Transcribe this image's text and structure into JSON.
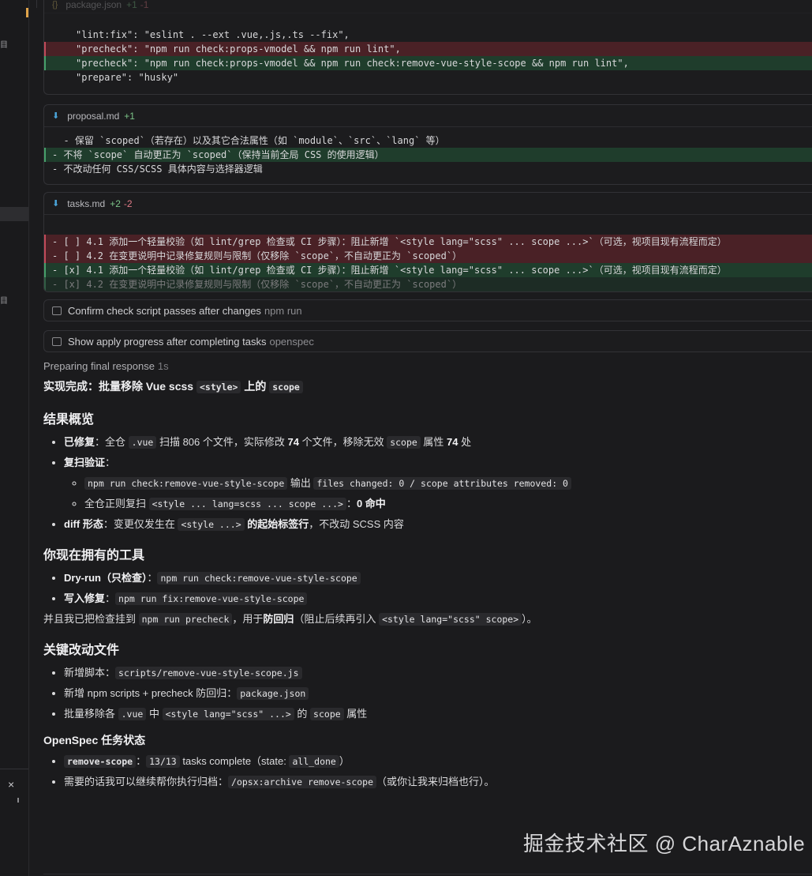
{
  "file1": {
    "name": "package.json",
    "added": "+1",
    "removed": "-1",
    "lines": [
      {
        "type": "ctx",
        "text": "\"lint:fix\": \"eslint . --ext .vue,.js,.ts --fix\","
      },
      {
        "type": "minus",
        "text": "\"precheck\": \"npm run check:props-vmodel && npm run lint\","
      },
      {
        "type": "plus",
        "text": "\"precheck\": \"npm run check:props-vmodel && npm run check:remove-vue-style-scope && npm run lint\","
      },
      {
        "type": "ctx",
        "text": "\"prepare\": \"husky\""
      }
    ]
  },
  "file2": {
    "name": "proposal.md",
    "added": "+1",
    "lines": [
      {
        "type": "ctx",
        "text": "  - 保留 `scoped`（若存在）以及其它合法属性（如 `module`、`src`、`lang` 等）"
      },
      {
        "type": "plus",
        "text": "- 不将 `scope` 自动更正为 `scoped`（保持当前全局 CSS 的使用逻辑）"
      },
      {
        "type": "ctx",
        "text": "- 不改动任何 CSS/SCSS 具体内容与选择器逻辑"
      }
    ]
  },
  "file3": {
    "name": "tasks.md",
    "added": "+2",
    "removed": "-2",
    "lines": [
      {
        "type": "minus",
        "text": "- [ ] 4.1 添加一个轻量校验（如 lint/grep 检查或 CI 步骤）：阻止新增 `<style lang=\"scss\" ... scope ...>`（可选，视项目现有流程而定）"
      },
      {
        "type": "minus",
        "text": "- [ ] 4.2 在变更说明中记录修复规则与限制（仅移除 `scope`，不自动更正为 `scoped`）"
      },
      {
        "type": "plus",
        "text": "- [x] 4.1 添加一个轻量校验（如 lint/grep 检查或 CI 步骤）：阻止新增 `<style lang=\"scss\" ... scope ...>`（可选，视项目现有流程而定）"
      },
      {
        "type": "plus",
        "text": "- [x] 4.2 在变更说明中记录修复规则与限制（仅移除 `scope`，不自动更正为 `scoped`）"
      }
    ]
  },
  "tasks": {
    "t1_label": "Confirm check script passes after changes",
    "t1_cmd": "npm run",
    "t2_label": "Show apply progress after completing tasks",
    "t2_cmd": "openspec"
  },
  "response": {
    "preparing": "Preparing final response",
    "preparing_time": "1s",
    "title_pre": "实现完成：批量移除 Vue scss ",
    "title_code1": "<style>",
    "title_mid": " 上的 ",
    "title_code2": "scope",
    "s1_heading": "结果概览",
    "s1_b1_label": "已修复",
    "s1_b1_a": "：全仓 ",
    "s1_b1_code1": ".vue",
    "s1_b1_b": " 扫描 806 个文件，实际修改 ",
    "s1_b1_num1": "74",
    "s1_b1_c": " 个文件，移除无效 ",
    "s1_b1_code2": "scope",
    "s1_b1_d": " 属性 ",
    "s1_b1_num2": "74",
    "s1_b1_e": " 处",
    "s1_b2_label": "复扫验证",
    "s1_b2_colon": "：",
    "s1_b2_sub1_code1": "npm run check:remove-vue-style-scope",
    "s1_b2_sub1_a": " 输出 ",
    "s1_b2_sub1_code2": "files changed: 0 / scope attributes removed: 0",
    "s1_b2_sub2_a": "全仓正则复扫 ",
    "s1_b2_sub2_code": "<style ... lang=scss ... scope ...>",
    "s1_b2_sub2_b": "：",
    "s1_b2_sub2_bold": "0 命中",
    "s1_b3_label": "diff 形态",
    "s1_b3_a": "：变更仅发生在 ",
    "s1_b3_code": "<style ...>",
    "s1_b3_bold": " 的起始标签行",
    "s1_b3_b": "，不改动 SCSS 内容",
    "s2_heading": "你现在拥有的工具",
    "s2_b1_label": "Dry-run（只检查）",
    "s2_b1_colon": "：",
    "s2_b1_code": "npm run check:remove-vue-style-scope",
    "s2_b2_label": "写入修复",
    "s2_b2_colon": "：",
    "s2_b2_code": "npm run fix:remove-vue-style-scope",
    "s2_p_a": "并且我已把检查挂到 ",
    "s2_p_code1": "npm run precheck",
    "s2_p_b": "，用于",
    "s2_p_bold": "防回归",
    "s2_p_c": "（阻止后续再引入 ",
    "s2_p_code2": "<style lang=\"scss\" scope>",
    "s2_p_d": "）。",
    "s3_heading": "关键改动文件",
    "s3_b1_a": "新增脚本：",
    "s3_b1_code": "scripts/remove-vue-style-scope.js",
    "s3_b2_a": "新增 npm scripts + precheck 防回归：",
    "s3_b2_code": "package.json",
    "s3_b3_a": "批量移除各 ",
    "s3_b3_code1": ".vue",
    "s3_b3_b": " 中 ",
    "s3_b3_code2": "<style lang=\"scss\" ...>",
    "s3_b3_c": " 的 ",
    "s3_b3_code3": "scope",
    "s3_b3_d": " 属性",
    "s4_heading": "OpenSpec 任务状态",
    "s4_b1_code1": "remove-scope",
    "s4_b1_colon": "：",
    "s4_b1_code2": "13/13",
    "s4_b1_a": " tasks complete（state: ",
    "s4_b1_code3": "all_done",
    "s4_b1_b": "）",
    "s4_b2_a": "需要的话我可以继续帮你执行归档：",
    "s4_b2_code": "/opsx:archive remove-scope",
    "s4_b2_b": "（或你让我来归档也行）。"
  },
  "watermark": "掘金技术社区 @ CharAznable",
  "icons": {
    "close": "×",
    "download": "⬇",
    "braces": "{}"
  }
}
